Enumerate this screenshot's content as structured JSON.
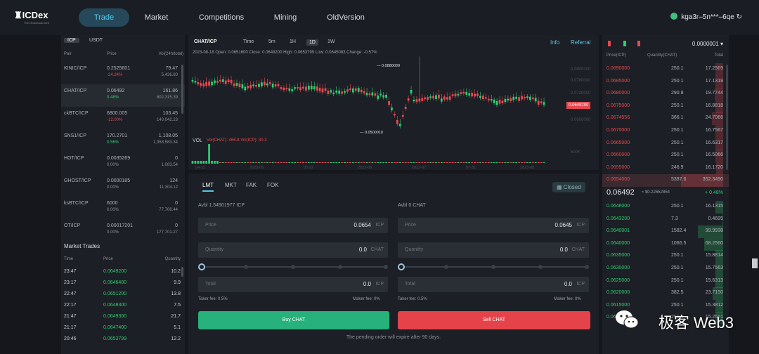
{
  "header": {
    "logo": "ICDex",
    "logo_sub": "The Orderbook DEX",
    "nav": [
      "Trade",
      "Market",
      "Competitions",
      "Mining",
      "OldVersion"
    ],
    "account": "kga3r–5n***–6qe"
  },
  "pairs": {
    "tabs": [
      "ICP",
      "USDT"
    ],
    "headers": [
      "Pair",
      "Price",
      "Vol(24h/total)"
    ],
    "items": [
      {
        "sym": "KINIC/ICP",
        "price": "0.2525601",
        "chg": "-24.24%",
        "vol": "79.47",
        "vol2": "5,436.80",
        "up": false
      },
      {
        "sym": "CHAT/ICP",
        "price": "0.06492",
        "chg": "0.48%",
        "vol": "161.86",
        "vol2": "602,315.39",
        "up": true
      },
      {
        "sym": "ckBTC/ICP",
        "price": "6800.005",
        "chg": "-12.00%",
        "vol": "103.45",
        "vol2": "140,042.23",
        "up": false
      },
      {
        "sym": "SNS1/ICP",
        "price": "170.2701",
        "chg": "0.56%",
        "vol": "1,108.05",
        "vol2": "1,358,583.34",
        "up": true
      },
      {
        "sym": "HOT/ICP",
        "price": "0.0035269",
        "chg": "0.00%",
        "vol": "0",
        "vol2": "1,083.54",
        "up": null
      },
      {
        "sym": "GHOST/ICP",
        "price": "0.0000185",
        "chg": "0.00%",
        "vol": "124",
        "vol2": "11,304.12",
        "up": null
      },
      {
        "sym": "ksBTC/ICP",
        "price": "6000",
        "chg": "0.00%",
        "vol": "0",
        "vol2": "77,708.44",
        "up": null
      },
      {
        "sym": "OT/ICP",
        "price": "0.00017201",
        "chg": "0.00%",
        "vol": "0",
        "vol2": "177,701.27",
        "up": null
      }
    ]
  },
  "market_trades": {
    "title": "Market Trades",
    "headers": [
      "Time",
      "Price",
      "Quantity"
    ],
    "rows": [
      {
        "t": "23:47",
        "p": "0.0649200",
        "q": "10.2"
      },
      {
        "t": "23:17",
        "p": "0.0646400",
        "q": "9.9"
      },
      {
        "t": "22:47",
        "p": "0.0651200",
        "q": "13.8"
      },
      {
        "t": "22:17",
        "p": "0.0648300",
        "q": "7.5"
      },
      {
        "t": "21:47",
        "p": "0.0649300",
        "q": "21.7"
      },
      {
        "t": "21:17",
        "p": "0.0647400",
        "q": "5.1"
      },
      {
        "t": "20:46",
        "p": "0.0653799",
        "q": "12.2"
      }
    ]
  },
  "chart": {
    "pair": "CHAT/ICP",
    "intervals": [
      "Time",
      "5m",
      "1H",
      "1D",
      "1W"
    ],
    "selected_interval": "1D",
    "info": "2023-08-18  Open: 0.0651600  Close: 0.0649200  High: 0.0653799  Low: 0.0645083  Change: -0.57%",
    "links": [
      "Info",
      "Referral"
    ],
    "hi_label": "0.0880000",
    "lo_label": "0.0500010",
    "last_price": "0.0649200",
    "vol_label": "VOL",
    "vol_info": "Vol(CHAT): 466.8   Vol(ICP): 30.3",
    "y_ticks": [
      "0.0800000",
      "0.0760000",
      "0.0720000",
      "0.0640000",
      "0.0600000"
    ],
    "vol_tick": "500K",
    "x_ticks": [
      "04-15",
      "2023-05",
      "05-22",
      "2023-06",
      "2023-07",
      "07-31",
      "2023-08"
    ]
  },
  "order_form": {
    "tabs": [
      "LMT",
      "MKT",
      "FAK",
      "FOK"
    ],
    "status": "Closed",
    "buy": {
      "avbl": "Avbl 1.54901977 ICP",
      "price": "0.0654",
      "price_unit": "ICP",
      "qty": "0.0",
      "qty_unit": "CHAT",
      "total": "0.0",
      "total_unit": "ICP",
      "taker": "Taker fee: 0.5%",
      "maker": "Maker fee: 0%",
      "btn": "Buy CHAT"
    },
    "sell": {
      "avbl": "Avbl 0 CHAT",
      "price": "0.0645",
      "price_unit": "ICP",
      "qty": "0.0",
      "qty_unit": "CHAT",
      "total": "0.0",
      "total_unit": "ICP",
      "taker": "Taker fee: 0.5%",
      "maker": "Maker fee: 0%",
      "btn": "Sell CHAT"
    },
    "labels": {
      "price": "Price",
      "qty": "Quantity",
      "total": "Total"
    },
    "note": "The pending order will expire after 90 days."
  },
  "orderbook": {
    "precision": "0.0000001",
    "headers": [
      "Price(ICP)",
      "Quantity(CHAT)",
      "Total"
    ],
    "asks": [
      {
        "p": "0.0690000",
        "q": "250.1",
        "t": "17.2569",
        "d": 0.18
      },
      {
        "p": "0.0685000",
        "q": "250.1",
        "t": "17.1319",
        "d": 0.18
      },
      {
        "p": "0.0680000",
        "q": "290.8",
        "t": "19.7744",
        "d": 0.2
      },
      {
        "p": "0.0675000",
        "q": "250.1",
        "t": "16.8818",
        "d": 0.18
      },
      {
        "p": "0.0674556",
        "q": "366.1",
        "t": "24.7066",
        "d": 0.26
      },
      {
        "p": "0.0670000",
        "q": "250.1",
        "t": "16.7567",
        "d": 0.18
      },
      {
        "p": "0.0665000",
        "q": "250.1",
        "t": "16.6317",
        "d": 0.18
      },
      {
        "p": "0.0660000",
        "q": "250.1",
        "t": "16.5066",
        "d": 0.18
      },
      {
        "p": "0.0655000",
        "q": "246.9",
        "t": "16.1720",
        "d": 0.17
      },
      {
        "p": "0.0654000",
        "q": "5387.6",
        "t": "352.3490",
        "d": 1.0
      }
    ],
    "last": "0.06492",
    "last_usd": "≈ $0.22652854",
    "last_chg": "+ 0.48%",
    "bids": [
      {
        "p": "0.0648000",
        "q": "250.1",
        "t": "16.1315",
        "d": 0.18
      },
      {
        "p": "0.0643200",
        "q": "7.3",
        "t": "0.4695",
        "d": 0.02
      },
      {
        "p": "0.0640001",
        "q": "1582.4",
        "t": "99.9938",
        "d": 0.6
      },
      {
        "p": "0.0640000",
        "q": "1066.5",
        "t": "68.2560",
        "d": 0.45
      },
      {
        "p": "0.0635000",
        "q": "250.1",
        "t": "15.8814",
        "d": 0.18
      },
      {
        "p": "0.0630000",
        "q": "250.1",
        "t": "15.7563",
        "d": 0.18
      },
      {
        "p": "0.0625000",
        "q": "250.1",
        "t": "15.6313",
        "d": 0.18
      },
      {
        "p": "0.0620000",
        "q": "382.5",
        "t": "23.7150",
        "d": 0.25
      },
      {
        "p": "0.0615000",
        "q": "250.1",
        "t": "15.3812",
        "d": 0.18
      },
      {
        "p": "0.0610000",
        "q": "250.1",
        "t": "15.2561",
        "d": 0.18
      }
    ]
  },
  "watermark": "极客 Web3",
  "colors": {
    "up": "#2ecc71",
    "down": "#e8484f",
    "accent": "#57c6e8"
  }
}
